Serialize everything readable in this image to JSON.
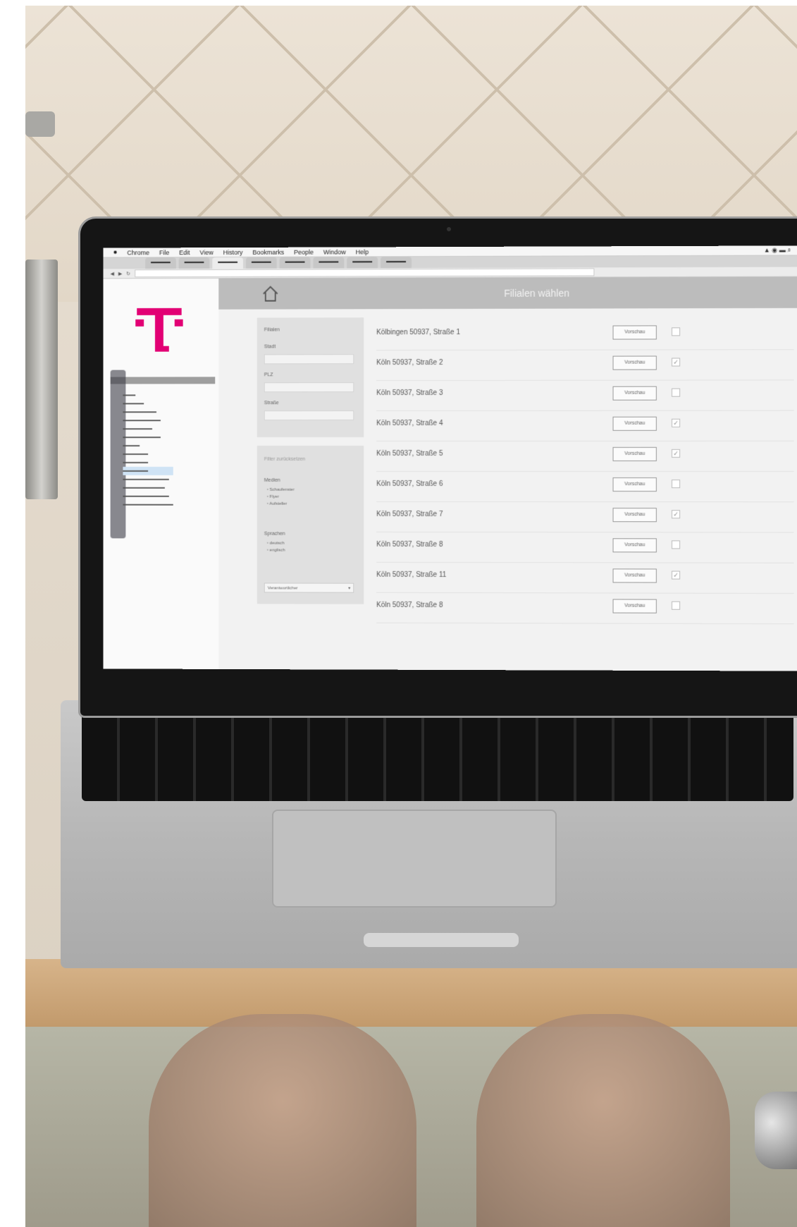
{
  "browser": {
    "menu": [
      "Chrome",
      "File",
      "Edit",
      "View",
      "History",
      "Bookmarks",
      "People",
      "Window",
      "Help"
    ]
  },
  "app": {
    "header": {
      "title": "Filialen wählen"
    },
    "filters": {
      "section_title": "Filialen",
      "fields": [
        {
          "label": "Stadt"
        },
        {
          "label": "PLZ"
        },
        {
          "label": "Straße"
        }
      ],
      "panel2": {
        "filter_title": "Filter zurücksetzen",
        "medien_label": "Medien",
        "medien_options": [
          "Schaufenster",
          "Flyer",
          "Aufsteller"
        ],
        "sprachen_label": "Sprachen",
        "sprachen_options": [
          "deutsch",
          "englisch"
        ],
        "select_value": "Verantwortlicher"
      }
    },
    "branches": [
      {
        "name": "Kölbingen 50937, Straße 1",
        "button": "Vorschau",
        "checked": false
      },
      {
        "name": "Köln 50937, Straße 2",
        "button": "Vorschau",
        "checked": true
      },
      {
        "name": "Köln 50937, Straße 3",
        "button": "Vorschau",
        "checked": false
      },
      {
        "name": "Köln 50937, Straße 4",
        "button": "Vorschau",
        "checked": true
      },
      {
        "name": "Köln 50937, Straße 5",
        "button": "Vorschau",
        "checked": true
      },
      {
        "name": "Köln 50937, Straße 6",
        "button": "Vorschau",
        "checked": false
      },
      {
        "name": "Köln 50937, Straße 7",
        "button": "Vorschau",
        "checked": true
      },
      {
        "name": "Köln 50937, Straße 8",
        "button": "Vorschau",
        "checked": false
      },
      {
        "name": "Köln 50937, Straße 11",
        "button": "Vorschau",
        "checked": true
      },
      {
        "name": "Köln 50937, Straße 8",
        "button": "Vorschau",
        "checked": false
      }
    ],
    "brand_color": "#e20074"
  }
}
